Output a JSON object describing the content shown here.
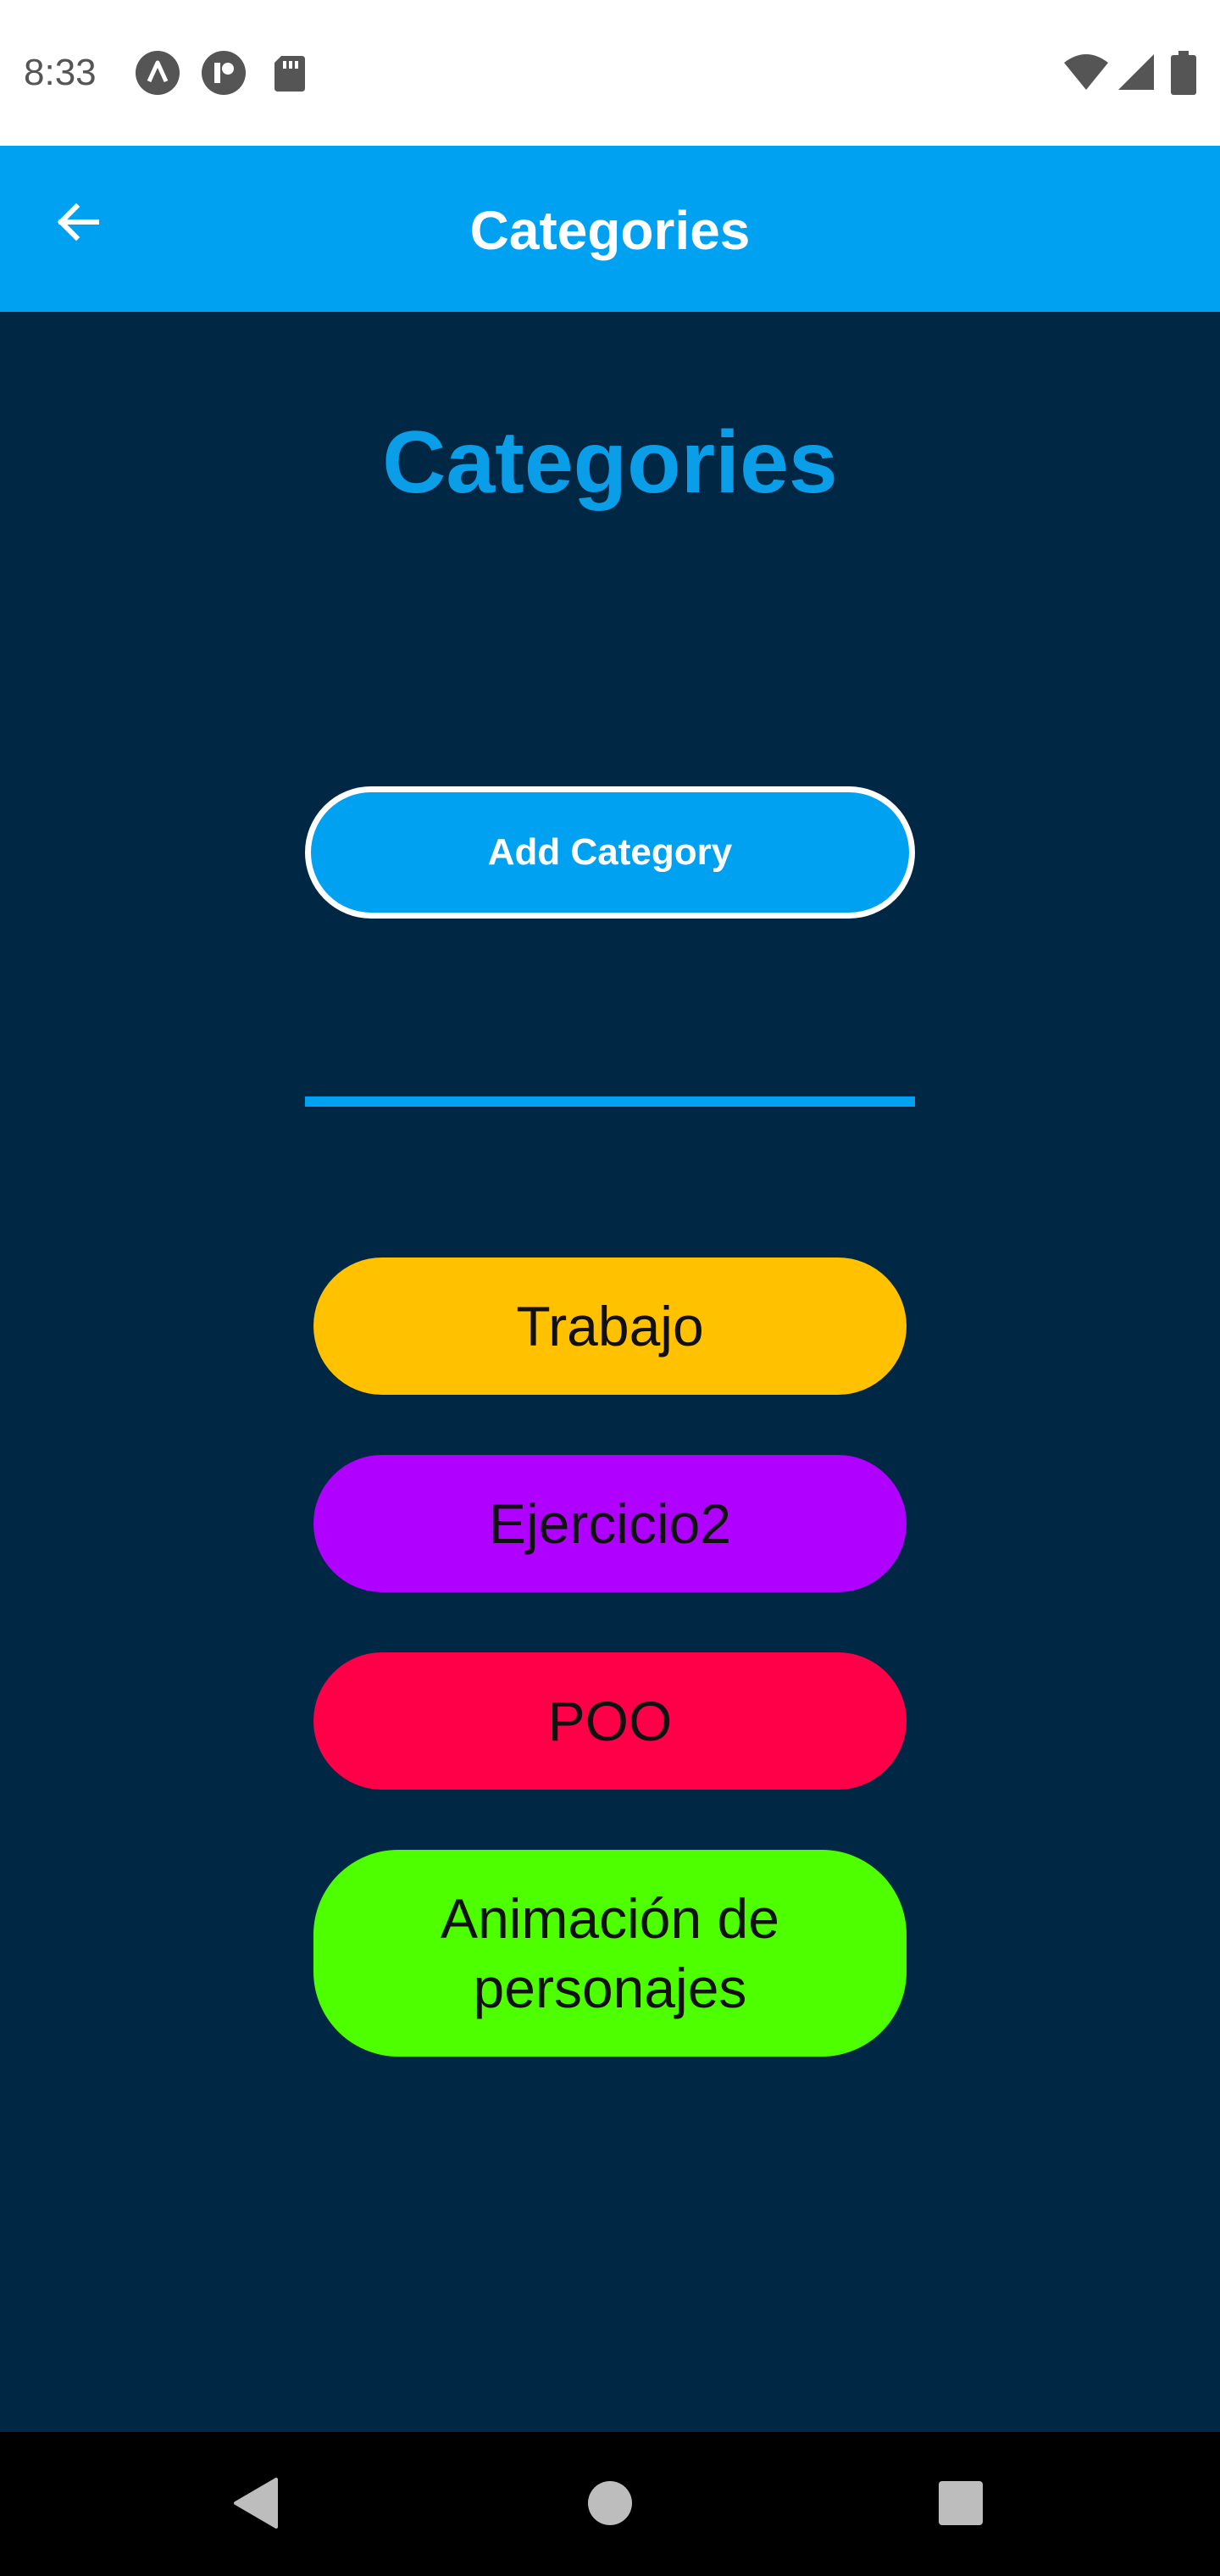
{
  "status_bar": {
    "time": "8:33",
    "icons": [
      "autofill-icon",
      "notification-icon",
      "sd-card-icon",
      "wifi-icon",
      "signal-icon",
      "battery-icon"
    ]
  },
  "app_bar": {
    "back_icon": "arrow-left-icon",
    "title": "Categories",
    "color": "#00a1f0"
  },
  "main": {
    "title": "Categories",
    "title_color": "#0a9ee8",
    "add_button_label": "Add Category",
    "background": "#002845"
  },
  "categories": [
    {
      "name": "Trabajo",
      "color": "#ffc100"
    },
    {
      "name": "Ejercicio2",
      "color": "#b000ff"
    },
    {
      "name": "POO",
      "color": "#ff0048"
    },
    {
      "name": "Animación de personajes",
      "color": "#4eff00"
    }
  ],
  "nav_bar": {
    "buttons": [
      "back-triangle-icon",
      "home-circle-icon",
      "recents-square-icon"
    ]
  }
}
